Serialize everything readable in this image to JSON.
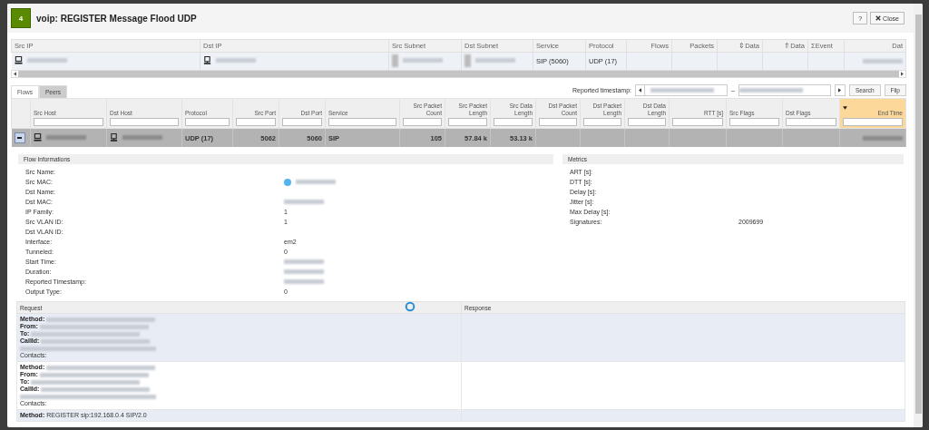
{
  "dialog": {
    "badge": "4",
    "title": "voip: REGISTER Message Flood UDP",
    "buttons": [
      {
        "kind": "help",
        "label": "?"
      },
      {
        "kind": "close",
        "label": "Close"
      }
    ]
  },
  "summary": {
    "columns": [
      "Src IP",
      "Dst IP",
      "Src Subnet",
      "Dst Subnet",
      "Service",
      "Protocol",
      "Flows",
      "Packets",
      "⇕Data",
      "⇑Data",
      "ΣEvent",
      "Dat"
    ],
    "row": {
      "src_ip": {
        "redacted": true
      },
      "dst_ip": {
        "redacted": true
      },
      "src_subnet": {
        "redacted": true
      },
      "dst_subnet": {
        "redacted": true
      },
      "service": "SIP (5060)",
      "protocol": "UDP (17)",
      "date": {
        "redacted": true
      }
    }
  },
  "tabs": [
    {
      "label": "Flows",
      "selected": true
    },
    {
      "label": "Peers",
      "selected": false
    }
  ],
  "timestamp": {
    "label": "Reported timestamp:",
    "separator": "–",
    "buttons": [
      "Search",
      "Flip"
    ]
  },
  "flows": {
    "columns": [
      {
        "label": "Src Host",
        "sorted": false
      },
      {
        "label": "Dst Host",
        "sorted": false
      },
      {
        "label": "Protocol",
        "sorted": false
      },
      {
        "label": "Src Port",
        "sorted": false
      },
      {
        "label": "Dst Port",
        "sorted": false
      },
      {
        "label": "Service",
        "sorted": false
      },
      {
        "label": "Src Packet Count",
        "sorted": false
      },
      {
        "label": "Src Packet Length",
        "sorted": false
      },
      {
        "label": "Src Data Length",
        "sorted": false
      },
      {
        "label": "Dst Packet Count",
        "sorted": false
      },
      {
        "label": "Dst Packet Length",
        "sorted": false
      },
      {
        "label": "Dst Data Length",
        "sorted": false
      },
      {
        "label": "RTT [s]",
        "sorted": false
      },
      {
        "label": "Src Flags",
        "sorted": false
      },
      {
        "label": "Dst Flags",
        "sorted": false
      },
      {
        "label": "End Time",
        "sorted": true
      }
    ],
    "row": {
      "expanded": true,
      "src_host": {
        "redacted": true
      },
      "dst_host": {
        "redacted": true
      },
      "protocol": "UDP (17)",
      "src_port": "5062",
      "dst_port": "5060",
      "service": "SIP",
      "src_packet_count": "105",
      "src_packet_length": "57.84 k",
      "src_data_length": "53.13 k",
      "end_time": {
        "redacted": true
      }
    }
  },
  "flow_info": {
    "title": "Flow Informations",
    "fields": [
      {
        "label": "Src Name:"
      },
      {
        "label": "Src MAC:",
        "redacted": true,
        "dot": true
      },
      {
        "label": "Dst Name:"
      },
      {
        "label": "Dst MAC:",
        "redacted": true
      },
      {
        "label": "IP Family:",
        "value": "1"
      },
      {
        "label": "Src VLAN ID:",
        "value": "1"
      },
      {
        "label": "Dst VLAN ID:"
      },
      {
        "label": "Interface:",
        "value": "em2"
      },
      {
        "label": "Tunneled:",
        "value": "0"
      },
      {
        "label": "Start Time:",
        "redacted": true
      },
      {
        "label": "Duration:",
        "redacted": true
      },
      {
        "label": "Reported Timestamp:",
        "redacted": true
      },
      {
        "label": "Output Type:",
        "value": "0"
      }
    ]
  },
  "metrics": {
    "title": "Metrics",
    "fields": [
      {
        "label": "ART [s]:"
      },
      {
        "label": "DTT [s]:"
      },
      {
        "label": "Delay [s]:"
      },
      {
        "label": "Jitter [s]:"
      },
      {
        "label": "Max Delay [s]:"
      },
      {
        "label": "Signatures:",
        "value": "2009699"
      }
    ]
  },
  "messages": {
    "columns": [
      "Request",
      "Response"
    ],
    "rows": [
      {
        "lines": [
          {
            "label": "Method:",
            "bold": true,
            "redacted": true
          },
          {
            "label": "From:",
            "bold": true,
            "redacted": true
          },
          {
            "label": "To:",
            "bold": true,
            "redacted": true
          },
          {
            "label": "CallId:",
            "bold": true,
            "redacted": true
          },
          {
            "redacted": true
          },
          {
            "label": "Contacts:",
            "bold": false
          }
        ]
      },
      {
        "lines": [
          {
            "label": "Method:",
            "bold": true,
            "redacted": true
          },
          {
            "label": "From:",
            "bold": true,
            "redacted": true
          },
          {
            "label": "To:",
            "bold": true,
            "redacted": true
          },
          {
            "label": "CallId:",
            "bold": true,
            "redacted": true
          },
          {
            "redacted": true
          },
          {
            "label": "Contacts:",
            "bold": false
          }
        ]
      },
      {
        "lines": [
          {
            "label": "Method:",
            "bold": true,
            "value": "REGISTER sip:192.168.0.4 SIP/2.0"
          }
        ]
      }
    ]
  }
}
